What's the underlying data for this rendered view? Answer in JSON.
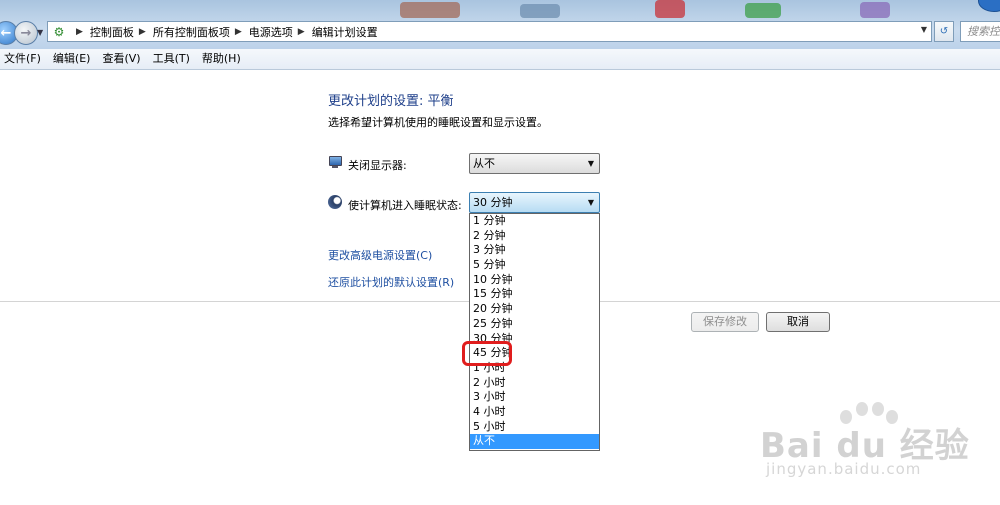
{
  "address_bar": {
    "breadcrumbs": [
      "控制面板",
      "所有控制面板项",
      "电源选项",
      "编辑计划设置"
    ],
    "search_placeholder": "搜索控"
  },
  "menu": {
    "items": [
      "文件(F)",
      "编辑(E)",
      "查看(V)",
      "工具(T)",
      "帮助(H)"
    ]
  },
  "page": {
    "heading": "更改计划的设置: 平衡",
    "subtext": "选择希望计算机使用的睡眠设置和显示设置。"
  },
  "display_setting": {
    "label": "关闭显示器:",
    "value": "从不"
  },
  "sleep_setting": {
    "label": "使计算机进入睡眠状态:",
    "value": "30 分钟",
    "options": [
      "1 分钟",
      "2 分钟",
      "3 分钟",
      "5 分钟",
      "10 分钟",
      "15 分钟",
      "20 分钟",
      "25 分钟",
      "30 分钟",
      "45 分钟",
      "1 小时",
      "2 小时",
      "3 小时",
      "4 小时",
      "5 小时",
      "从不"
    ],
    "highlighted_option": "从不",
    "circled_option": "45 分钟"
  },
  "links": {
    "advanced": "更改高级电源设置(C)",
    "restore": "还原此计划的默认设置(R)"
  },
  "buttons": {
    "save": "保存修改",
    "cancel": "取消"
  },
  "watermark": {
    "main": "Bai du 经验",
    "url": "jingyan.baidu.com"
  },
  "colors": {
    "heading": "#1e3f8a",
    "link": "#1e4fa1",
    "selection": "#3399ff",
    "annotation": "#e01d1d"
  }
}
